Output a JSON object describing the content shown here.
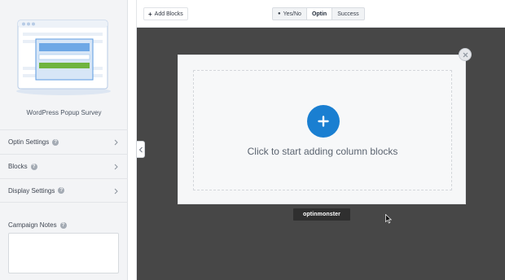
{
  "sidebar": {
    "campaign_name": "WordPress Popup Survey",
    "menu": [
      {
        "label": "Optin Settings",
        "help": "?"
      },
      {
        "label": "Blocks",
        "help": "?"
      },
      {
        "label": "Display Settings",
        "help": "?"
      }
    ],
    "notes_label": "Campaign Notes",
    "notes_help": "?",
    "notes_value": ""
  },
  "toolbar": {
    "add_blocks_label": "Add Blocks",
    "view_tabs": [
      {
        "label": "Yes/No",
        "active": false
      },
      {
        "label": "Optin",
        "active": true
      },
      {
        "label": "Success",
        "active": false
      }
    ]
  },
  "canvas": {
    "drop_text": "Click to start adding column blocks",
    "brand_badge": "optinmonster"
  },
  "colors": {
    "accent": "#1a7fd1",
    "canvas_bg": "#474747",
    "sidebar_bg": "#f3f4f6",
    "preview_green": "#6fb43f"
  },
  "icons": [
    "plus-icon",
    "chevron-right-icon",
    "chevron-left-icon",
    "close-icon",
    "help-icon",
    "mouse-cursor-icon"
  ]
}
